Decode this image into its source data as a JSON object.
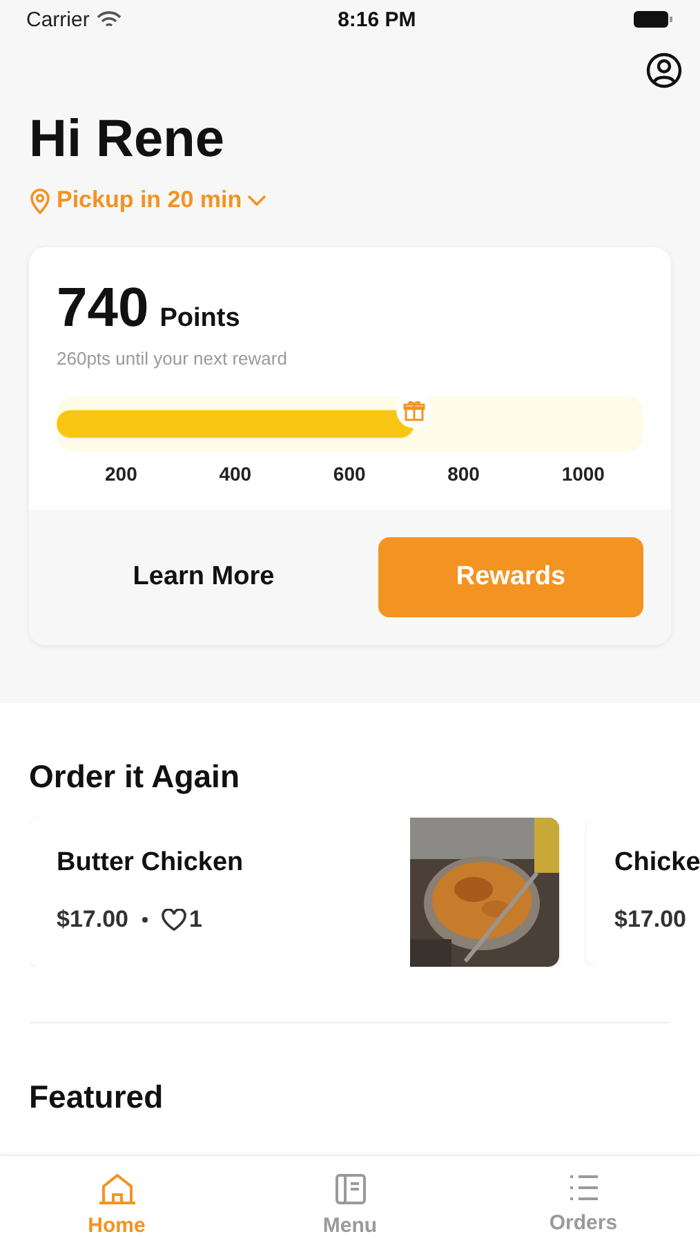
{
  "status_bar": {
    "carrier": "Carrier",
    "time": "8:16 PM"
  },
  "greeting": "Hi Rene",
  "pickup": "Pickup in 20 min",
  "rewards_card": {
    "points": "740",
    "points_label": "Points",
    "subtitle": "260pts until your next reward",
    "progress": {
      "level": 0.61
    },
    "ticks": [
      "200",
      "400",
      "600",
      "800",
      "1000"
    ],
    "learn_more": "Learn More",
    "rewards_button": "Rewards"
  },
  "order_again": {
    "title": "Order it Again",
    "items": [
      {
        "name": "Butter Chicken",
        "price": "$17.00",
        "likes": "1",
        "kind": "picture"
      },
      {
        "name": "Chicke",
        "price": "$17.00"
      }
    ]
  },
  "featured": {
    "title": "Featured"
  },
  "tab_bar": [
    {
      "label": "Home",
      "selected": true
    },
    {
      "label": "Menu",
      "selected": false
    },
    {
      "label": "Orders",
      "selected": false
    }
  ]
}
